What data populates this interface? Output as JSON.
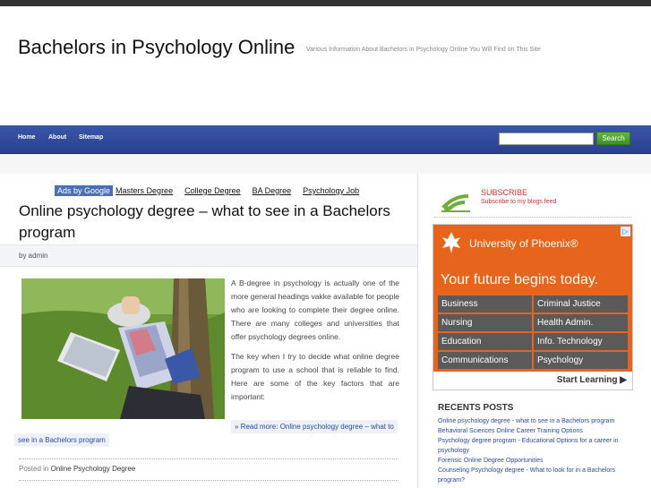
{
  "site": {
    "title": "Bachelors in Psychology Online",
    "tagline": "Various Information About Bachelors in Psychology Online You Will Find on This Site"
  },
  "nav": {
    "items": [
      "Home",
      "About",
      "Sitemap"
    ],
    "search_button": "Search",
    "search_placeholder": ""
  },
  "ads": {
    "label": "Ads by Google",
    "links": [
      "Masters Degree",
      "College Degree",
      "BA Degree",
      "Psychology Job"
    ]
  },
  "post": {
    "title": "Online psychology degree – what to see in a Bachelors program",
    "byline": "by admin",
    "paragraphs": [
      "A B-degree in psychology is actually one of the more general headings vakke available for people who are looking to complete their degree online. There are many colleges and universities that offer psychology degrees online.",
      "The key when I try to decide what online degree program to use a school that is reliable to find. Here are some of the key factors that are important:"
    ],
    "read_more_line1": "» Read more: Online psychology degree – what to",
    "read_more_line2": "see in a Bachelors program",
    "posted_in_label": "Posted in",
    "category": "Online Psychology Degree"
  },
  "sidebar": {
    "subscribe_title": "SUBSCRIBE",
    "subscribe_sub": "Subscribe to my blogs feed",
    "ad": {
      "brand": "University of Phoenix®",
      "headline": "Your future begins today.",
      "cells": [
        "Business",
        "Criminal Justice",
        "Nursing",
        "Health Admin.",
        "Education",
        "Info. Technology",
        "Communications",
        "Psychology"
      ],
      "cta": "Start Learning ▶",
      "choice": "▷",
      "color": "#e6641b"
    },
    "recent_title": "RECENTS POSTS",
    "recent_posts": [
      "Online psychology degree - what to see in a Bachelors program",
      "Behavioral Sciences Online Career Training Options",
      "Psychology degree program - Educational Options for a career in psychology",
      "Forensic Online Degree Opportunities",
      "Counseling Psychology degree - What to look for in a Bachelors program?"
    ]
  }
}
